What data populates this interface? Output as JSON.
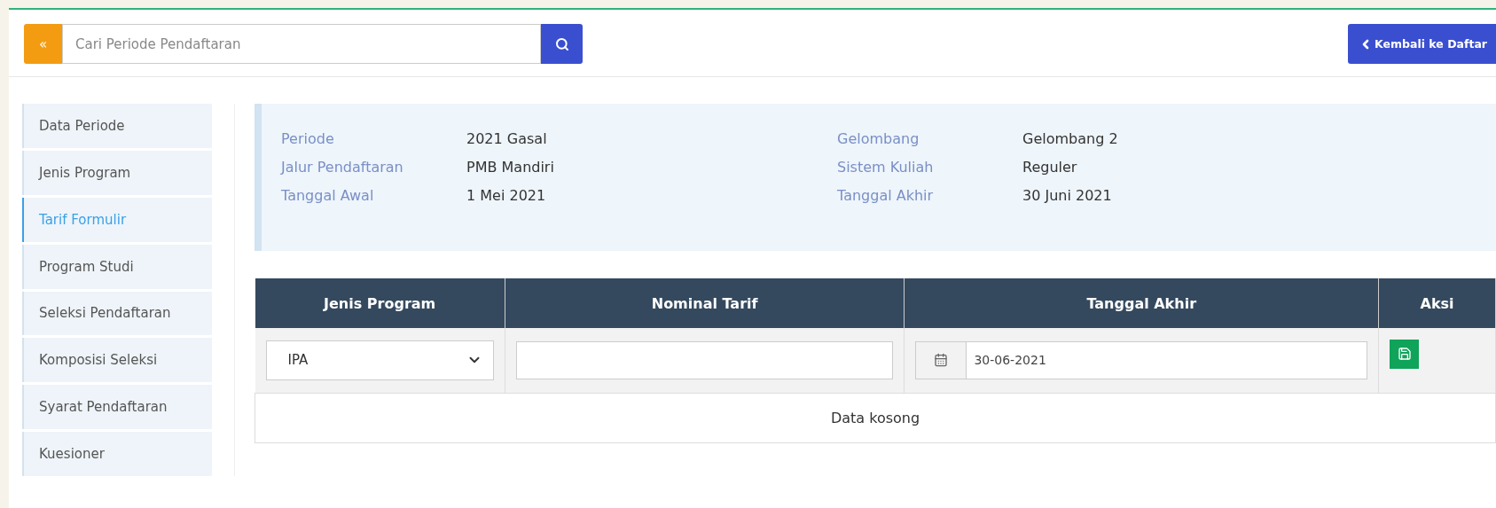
{
  "toolbar": {
    "collapse_button": "«",
    "search": {
      "placeholder": "Cari Periode Pendaftaran"
    },
    "back_button": "Kembali ke Daftar"
  },
  "sidebar": {
    "items": [
      {
        "label": "Data Periode",
        "selected": false
      },
      {
        "label": "Jenis Program",
        "selected": false
      },
      {
        "label": "Tarif Formulir",
        "selected": true
      },
      {
        "label": "Program Studi",
        "selected": false
      },
      {
        "label": "Seleksi Pendaftaran",
        "selected": false
      },
      {
        "label": "Komposisi Seleksi",
        "selected": false
      },
      {
        "label": "Syarat Pendaftaran",
        "selected": false
      },
      {
        "label": "Kuesioner",
        "selected": false
      }
    ]
  },
  "info": {
    "left": [
      {
        "label": "Periode",
        "value": "2021 Gasal"
      },
      {
        "label": "Jalur Pendaftaran",
        "value": "PMB Mandiri"
      },
      {
        "label": "Tanggal Awal",
        "value": "1 Mei 2021"
      }
    ],
    "right": [
      {
        "label": "Gelombang",
        "value": "Gelombang 2"
      },
      {
        "label": "Sistem Kuliah",
        "value": "Reguler"
      },
      {
        "label": "Tanggal Akhir",
        "value": "30 Juni 2021"
      }
    ]
  },
  "table": {
    "columns": [
      "Jenis Program",
      "Nominal Tarif",
      "Tanggal Akhir",
      "Aksi"
    ],
    "form_row": {
      "program": "IPA",
      "date": "30-06-2021"
    },
    "empty_message": "Data kosong"
  }
}
